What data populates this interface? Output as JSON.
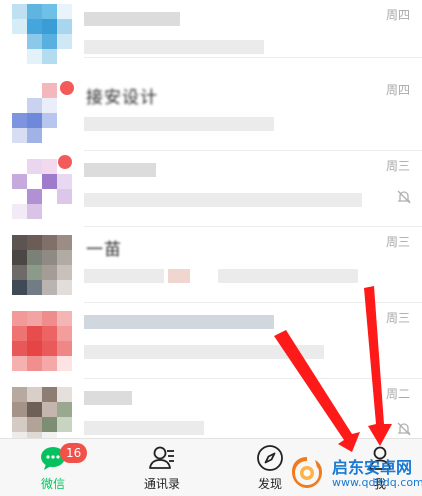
{
  "chats": [
    {
      "date": "周四",
      "name": ""
    },
    {
      "date": "周四",
      "name": "接安设计"
    },
    {
      "date": "周三",
      "name": ""
    },
    {
      "date": "周三",
      "name": "一苗"
    },
    {
      "date": "周三",
      "name": ""
    },
    {
      "date": "周二",
      "name": ""
    }
  ],
  "tabs": [
    {
      "label": "微信",
      "badge": "16",
      "icon": "chat-bubble-icon",
      "active": true
    },
    {
      "label": "通讯录",
      "icon": "contacts-icon",
      "active": false
    },
    {
      "label": "发现",
      "icon": "compass-icon",
      "active": false
    },
    {
      "label": "我",
      "icon": "person-icon",
      "active": false
    }
  ],
  "watermark": {
    "title": "启东安卓网",
    "url": "www.qdltdq.com"
  },
  "colors": {
    "accent": "#07c160",
    "badge": "#f2514a",
    "arrow": "#ff1a1a"
  }
}
